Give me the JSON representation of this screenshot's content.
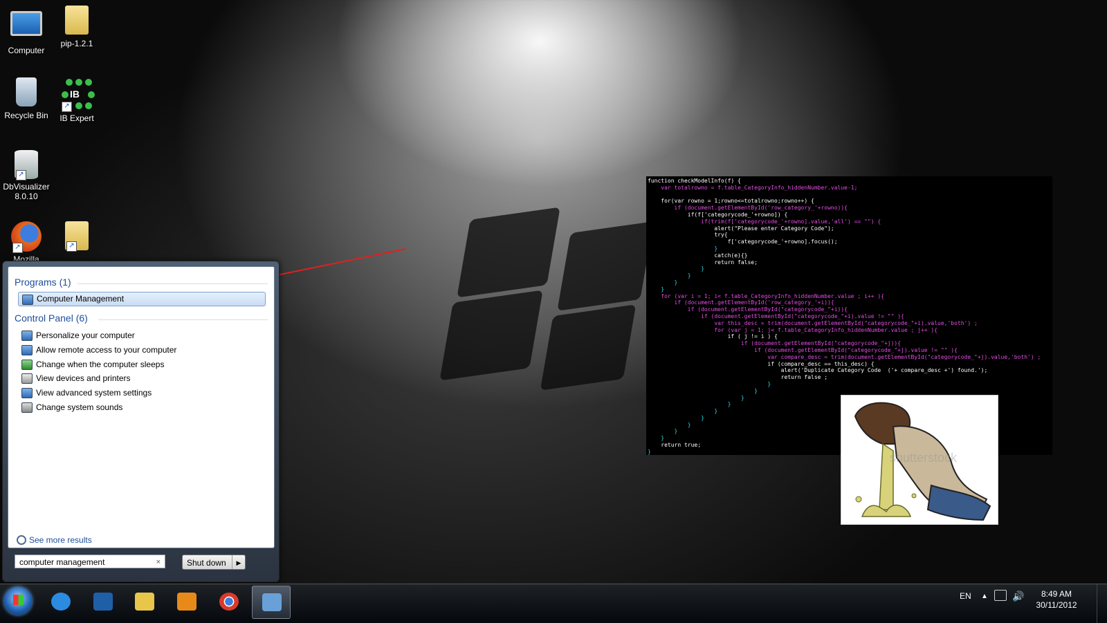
{
  "desktop": {
    "icons": [
      {
        "label": "Computer",
        "icon": "computer-icon"
      },
      {
        "label": "pip-1.2.1",
        "icon": "folder-icon"
      },
      {
        "label": "Recycle Bin",
        "icon": "recycle-bin-icon"
      },
      {
        "label": "IB Expert",
        "icon": "ib-expert-icon"
      },
      {
        "label": "DbVisualizer",
        "label2": "8.0.10",
        "icon": "dbvisualizer-icon"
      },
      {
        "label": "Mozilla",
        "icon": "firefox-icon"
      },
      {
        "label": "",
        "icon": "folder-shortcut-icon"
      }
    ]
  },
  "code": {
    "lines": [
      "function checkModelInfo(f) {",
      "    var totalrowno = f.table_CategoryInfo_hiddenNumber.value-1;",
      "",
      "    for(var rowno = 1;rowno<=totalrowno;rowno++) {",
      "        if (document.getElementById('row_category_'+rowno)){",
      "            if(f['categorycode_'+rowno]) {",
      "                if(trim(f['categorycode_'+rowno].value,'all') == \"\") {",
      "                    alert(\"Please enter Category Code\");",
      "                    try{",
      "                        f['categorycode_'+rowno].focus();",
      "                    }",
      "                    catch(e){}",
      "                    return false;",
      "                }",
      "            }",
      "        }",
      "    }",
      "    for (var i = 1; i< f.table_CategoryInfo_hiddenNumber.value ; i++ ){",
      "        if (document.getElementById('row_category_'+i)){",
      "            if (document.getElementById(\"categorycode_\"+i)){",
      "                if (document.getElementById(\"categorycode_\"+i).value != \"\" ){",
      "                    var this_desc = trim(document.getElementById(\"categorycode_\"+i).value,'both') ;",
      "                    for (var j = 1; j< f.table_CategoryInfo_hiddenNumber.value ; j++ ){",
      "                        if ( j != i ) {",
      "                            if (document.getElementById(\"categorycode_\"+j)){",
      "                                if (document.getElementById(\"categorycode_\"+j).value != \"\" ){",
      "                                    var compare_desc = trim(document.getElementById(\"categorycode_\"+j).value,'both') ;",
      "                                    if (compare_desc == this_desc) {",
      "                                        alert('Duplicate Category Code  ('+ compare_desc +') found.');",
      "                                        return false ;",
      "                                    }",
      "                                }",
      "                            }",
      "                        }",
      "                    }",
      "                }",
      "            }",
      "        }",
      "    }",
      "    return true;",
      "}"
    ]
  },
  "cartoon": {
    "watermark": "shutterstock"
  },
  "start_menu": {
    "programs_heading": "Programs (1)",
    "programs": [
      {
        "label": "Computer Management",
        "icon": "computer-management-icon",
        "selected": true
      }
    ],
    "control_panel_heading": "Control Panel (6)",
    "control_panel": [
      {
        "label": "Personalize your computer",
        "icon": "personalize-icon"
      },
      {
        "label": "Allow remote access to your computer",
        "icon": "remote-access-icon"
      },
      {
        "label": "Change when the computer sleeps",
        "icon": "power-options-icon"
      },
      {
        "label": "View devices and printers",
        "icon": "devices-printers-icon"
      },
      {
        "label": "View advanced system settings",
        "icon": "system-settings-icon"
      },
      {
        "label": "Change system sounds",
        "icon": "sound-icon"
      }
    ],
    "see_more": "See more results",
    "search_value": "computer management",
    "search_clear": "×",
    "shutdown_label": "Shut down"
  },
  "taskbar": {
    "pinned": [
      {
        "icon": "internet-explorer-icon",
        "color": "#2b8be0"
      },
      {
        "icon": "powershell-icon",
        "color": "#1f5fa8"
      },
      {
        "icon": "windows-explorer-icon",
        "color": "#e8c64a"
      },
      {
        "icon": "media-player-icon",
        "color": "#e88a1a"
      },
      {
        "icon": "chrome-icon",
        "color": "#d93a2b"
      },
      {
        "icon": "computer-management-taskbar-icon",
        "color": "#6aa0d8",
        "active": true
      }
    ],
    "language": "EN",
    "time": "8:49 AM",
    "date": "30/11/2012"
  }
}
